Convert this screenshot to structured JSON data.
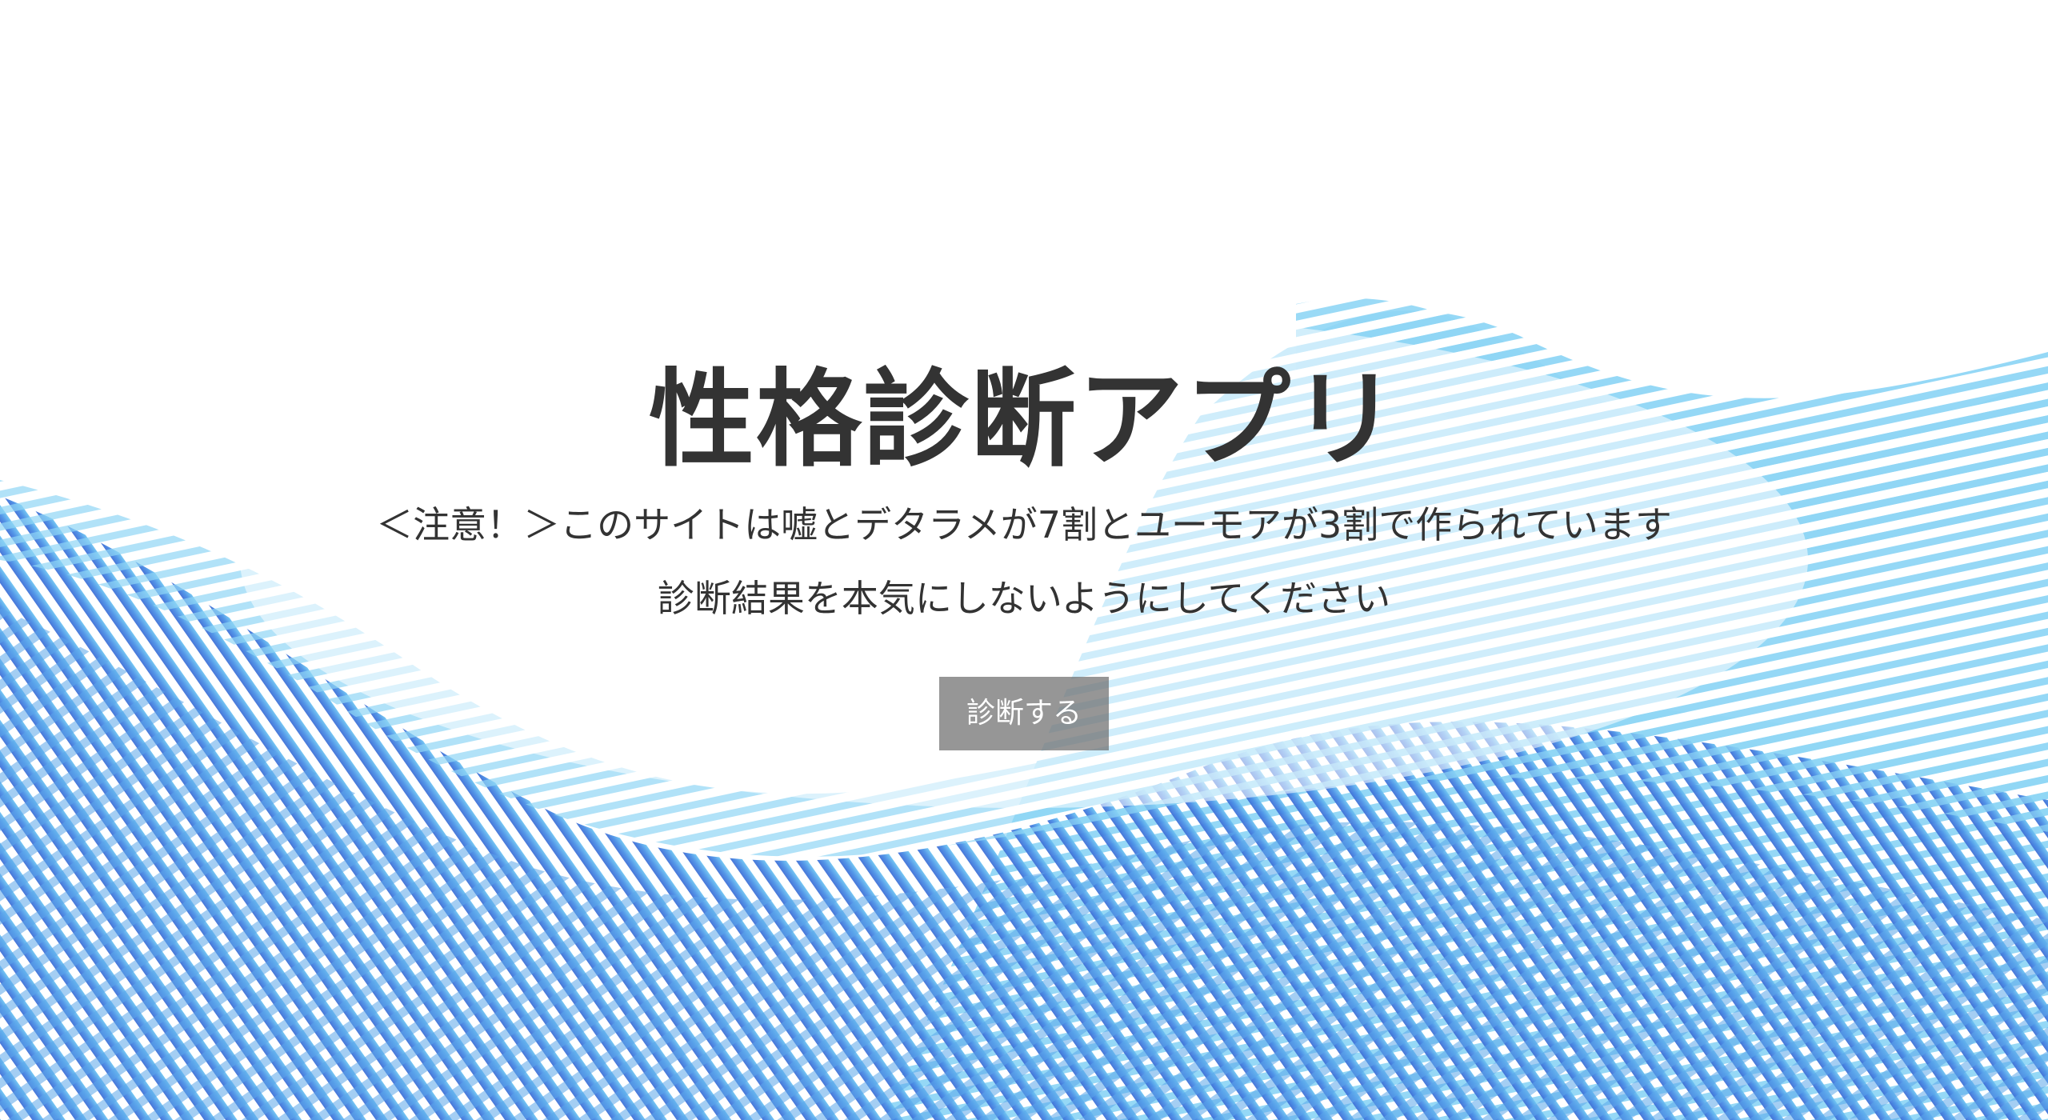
{
  "hero": {
    "title": "性格診断アプリ",
    "notice_line1": "＜注意！＞このサイトは嘘とデタラメが7割とユーモアが3割で作られています",
    "notice_line2": "診断結果を本気にしないようにしてください",
    "button_label": "診断する"
  },
  "colors": {
    "text": "#333333",
    "button_bg": "#6e6e6e",
    "wave_light": "#8fd6f5",
    "wave_dark": "#3f74d8"
  }
}
